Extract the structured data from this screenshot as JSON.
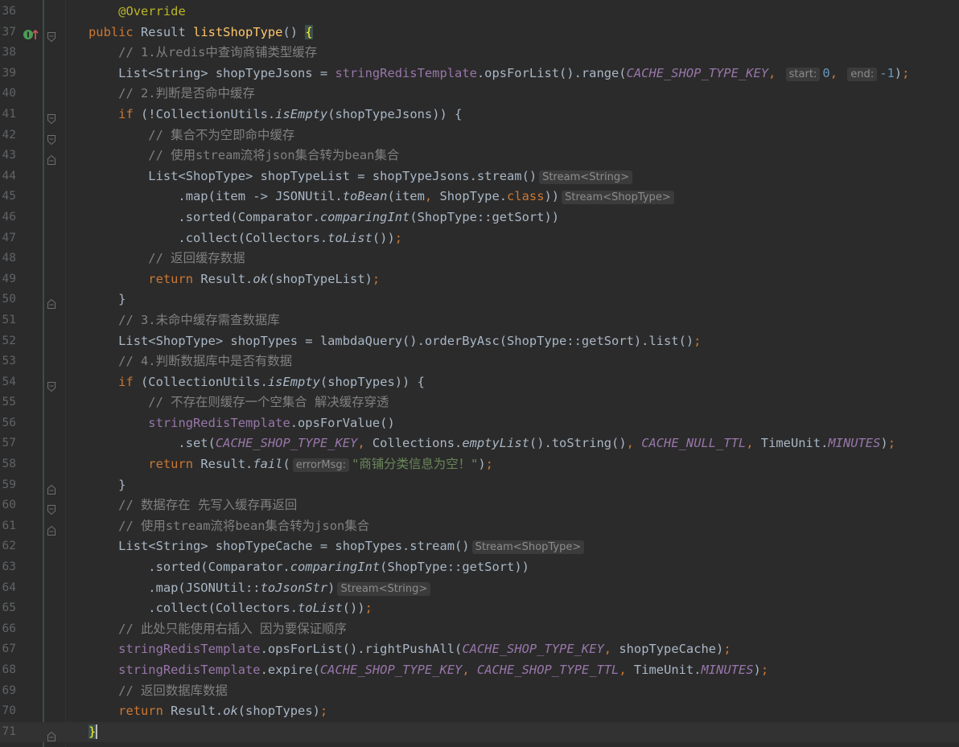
{
  "editor": {
    "current_line": 71,
    "lines": [
      {
        "n": "36",
        "fold": false,
        "tokens": [
          [
            "p",
            "    "
          ],
          [
            "ann",
            "@Override"
          ]
        ]
      },
      {
        "n": "37",
        "fold": true,
        "mark": "override-implements-icon",
        "tokens": [
          [
            "kw",
            "public "
          ],
          [
            "p",
            "Result "
          ],
          [
            "fn",
            "listShopType"
          ],
          [
            "p",
            "() "
          ],
          [
            "brace",
            "{"
          ]
        ]
      },
      {
        "n": "38",
        "tokens": [
          [
            "p",
            "    "
          ],
          [
            "cm",
            "// 1.从redis中查询商铺类型缓存"
          ]
        ]
      },
      {
        "n": "39",
        "tokens": [
          [
            "p",
            "    List<String> shopTypeJsons = "
          ],
          [
            "fld",
            "stringRedisTemplate"
          ],
          [
            "p",
            ".opsForList().range("
          ],
          [
            "st",
            "CACHE_SHOP_TYPE_KEY"
          ],
          [
            "kw",
            ", "
          ],
          [
            "hint",
            "start:"
          ],
          [
            "num",
            "0"
          ],
          [
            "kw",
            ", "
          ],
          [
            "hint",
            "end:"
          ],
          [
            "num",
            "-1"
          ],
          [
            "p",
            ")"
          ],
          [
            "kw",
            ";"
          ]
        ]
      },
      {
        "n": "40",
        "tokens": [
          [
            "p",
            "    "
          ],
          [
            "cm",
            "// 2.判断是否命中缓存"
          ]
        ]
      },
      {
        "n": "41",
        "fold": true,
        "tokens": [
          [
            "p",
            "    "
          ],
          [
            "kw",
            "if"
          ],
          [
            "p",
            " (!CollectionUtils."
          ],
          [
            "it",
            "isEmpty"
          ],
          [
            "p",
            "(shopTypeJsons)) {"
          ]
        ]
      },
      {
        "n": "42",
        "fold": true,
        "tokens": [
          [
            "p",
            "        "
          ],
          [
            "cm",
            "// 集合不为空即命中缓存"
          ]
        ]
      },
      {
        "n": "43",
        "fold": true,
        "tokens": [
          [
            "p",
            "        "
          ],
          [
            "cm",
            "// 使用stream流将json集合转为bean集合"
          ]
        ]
      },
      {
        "n": "44",
        "tokens": [
          [
            "p",
            "        List<ShopType> shopTypeList = shopTypeJsons.stream()"
          ],
          [
            "hint",
            "Stream<String>"
          ]
        ]
      },
      {
        "n": "45",
        "tokens": [
          [
            "p",
            "            .map(item -> JSONUtil."
          ],
          [
            "it",
            "toBean"
          ],
          [
            "p",
            "(item"
          ],
          [
            "kw",
            ", "
          ],
          [
            "p",
            "ShopType."
          ],
          [
            "kw",
            "class"
          ],
          [
            "p",
            "))"
          ],
          [
            "hint",
            "Stream<ShopType>"
          ]
        ]
      },
      {
        "n": "46",
        "tokens": [
          [
            "p",
            "            .sorted(Comparator."
          ],
          [
            "it",
            "comparingInt"
          ],
          [
            "p",
            "(ShopType::getSort))"
          ]
        ]
      },
      {
        "n": "47",
        "tokens": [
          [
            "p",
            "            .collect(Collectors."
          ],
          [
            "it",
            "toList"
          ],
          [
            "p",
            "())"
          ],
          [
            "kw",
            ";"
          ]
        ]
      },
      {
        "n": "48",
        "tokens": [
          [
            "p",
            "        "
          ],
          [
            "cm",
            "// 返回缓存数据"
          ]
        ]
      },
      {
        "n": "49",
        "tokens": [
          [
            "p",
            "        "
          ],
          [
            "kw",
            "return "
          ],
          [
            "p",
            "Result."
          ],
          [
            "it",
            "ok"
          ],
          [
            "p",
            "(shopTypeList)"
          ],
          [
            "kw",
            ";"
          ]
        ]
      },
      {
        "n": "50",
        "fold": true,
        "tokens": [
          [
            "p",
            "    }"
          ]
        ]
      },
      {
        "n": "51",
        "tokens": [
          [
            "p",
            "    "
          ],
          [
            "cm",
            "// 3.未命中缓存需查数据库"
          ]
        ]
      },
      {
        "n": "52",
        "tokens": [
          [
            "p",
            "    List<ShopType> shopTypes = lambdaQuery().orderByAsc(ShopType::getSort).list()"
          ],
          [
            "kw",
            ";"
          ]
        ]
      },
      {
        "n": "53",
        "tokens": [
          [
            "p",
            "    "
          ],
          [
            "cm",
            "// 4.判断数据库中是否有数据"
          ]
        ]
      },
      {
        "n": "54",
        "fold": true,
        "tokens": [
          [
            "p",
            "    "
          ],
          [
            "kw",
            "if "
          ],
          [
            "p",
            "(CollectionUtils."
          ],
          [
            "it",
            "isEmpty"
          ],
          [
            "p",
            "(shopTypes)) {"
          ]
        ]
      },
      {
        "n": "55",
        "tokens": [
          [
            "p",
            "        "
          ],
          [
            "cm",
            "// 不存在则缓存一个空集合 解决缓存穿透"
          ]
        ]
      },
      {
        "n": "56",
        "tokens": [
          [
            "p",
            "        "
          ],
          [
            "fld",
            "stringRedisTemplate"
          ],
          [
            "p",
            ".opsForValue()"
          ]
        ]
      },
      {
        "n": "57",
        "tokens": [
          [
            "p",
            "            .set("
          ],
          [
            "st",
            "CACHE_SHOP_TYPE_KEY"
          ],
          [
            "kw",
            ", "
          ],
          [
            "p",
            "Collections."
          ],
          [
            "it",
            "emptyList"
          ],
          [
            "p",
            "().toString()"
          ],
          [
            "kw",
            ", "
          ],
          [
            "st",
            "CACHE_NULL_TTL"
          ],
          [
            "kw",
            ", "
          ],
          [
            "p",
            "TimeUnit."
          ],
          [
            "st",
            "MINUTES"
          ],
          [
            "p",
            ")"
          ],
          [
            "kw",
            ";"
          ]
        ]
      },
      {
        "n": "58",
        "tokens": [
          [
            "p",
            "        "
          ],
          [
            "kw",
            "return "
          ],
          [
            "p",
            "Result."
          ],
          [
            "it",
            "fail"
          ],
          [
            "p",
            "("
          ],
          [
            "hint",
            "errorMsg:"
          ],
          [
            "str",
            "\"商铺分类信息为空！\""
          ],
          [
            "p",
            ")"
          ],
          [
            "kw",
            ";"
          ]
        ]
      },
      {
        "n": "59",
        "fold": true,
        "tokens": [
          [
            "p",
            "    }"
          ]
        ]
      },
      {
        "n": "60",
        "fold": true,
        "tokens": [
          [
            "p",
            "    "
          ],
          [
            "cm",
            "// 数据存在 先写入缓存再返回"
          ]
        ]
      },
      {
        "n": "61",
        "fold": true,
        "tokens": [
          [
            "p",
            "    "
          ],
          [
            "cm",
            "// 使用stream流将bean集合转为json集合"
          ]
        ]
      },
      {
        "n": "62",
        "tokens": [
          [
            "p",
            "    List<String> shopTypeCache = shopTypes.stream()"
          ],
          [
            "hint",
            "Stream<ShopType>"
          ]
        ]
      },
      {
        "n": "63",
        "tokens": [
          [
            "p",
            "        .sorted(Comparator."
          ],
          [
            "it",
            "comparingInt"
          ],
          [
            "p",
            "(ShopType::getSort))"
          ]
        ]
      },
      {
        "n": "64",
        "tokens": [
          [
            "p",
            "        .map(JSONUtil::"
          ],
          [
            "it",
            "toJsonStr"
          ],
          [
            "p",
            ")"
          ],
          [
            "hint",
            "Stream<String>"
          ]
        ]
      },
      {
        "n": "65",
        "tokens": [
          [
            "p",
            "        .collect(Collectors."
          ],
          [
            "it",
            "toList"
          ],
          [
            "p",
            "())"
          ],
          [
            "kw",
            ";"
          ]
        ]
      },
      {
        "n": "66",
        "tokens": [
          [
            "p",
            "    "
          ],
          [
            "cm",
            "// 此处只能使用右插入 因为要保证顺序"
          ]
        ]
      },
      {
        "n": "67",
        "tokens": [
          [
            "p",
            "    "
          ],
          [
            "fld",
            "stringRedisTemplate"
          ],
          [
            "p",
            ".opsForList().rightPushAll("
          ],
          [
            "st",
            "CACHE_SHOP_TYPE_KEY"
          ],
          [
            "kw",
            ", "
          ],
          [
            "p",
            "shopTypeCache)"
          ],
          [
            "kw",
            ";"
          ]
        ]
      },
      {
        "n": "68",
        "tokens": [
          [
            "p",
            "    "
          ],
          [
            "fld",
            "stringRedisTemplate"
          ],
          [
            "p",
            ".expire("
          ],
          [
            "st",
            "CACHE_SHOP_TYPE_KEY"
          ],
          [
            "kw",
            ", "
          ],
          [
            "st",
            "CACHE_SHOP_TYPE_TTL"
          ],
          [
            "kw",
            ", "
          ],
          [
            "p",
            "TimeUnit."
          ],
          [
            "st",
            "MINUTES"
          ],
          [
            "p",
            ")"
          ],
          [
            "kw",
            ";"
          ]
        ]
      },
      {
        "n": "69",
        "tokens": [
          [
            "p",
            "    "
          ],
          [
            "cm",
            "// 返回数据库数据"
          ]
        ]
      },
      {
        "n": "70",
        "tokens": [
          [
            "p",
            "    "
          ],
          [
            "kw",
            "return "
          ],
          [
            "p",
            "Result."
          ],
          [
            "it",
            "ok"
          ],
          [
            "p",
            "(shopTypes)"
          ],
          [
            "kw",
            ";"
          ]
        ]
      },
      {
        "n": "71",
        "fold": true,
        "tokens": [
          [
            "brace",
            "}"
          ]
        ]
      }
    ]
  }
}
